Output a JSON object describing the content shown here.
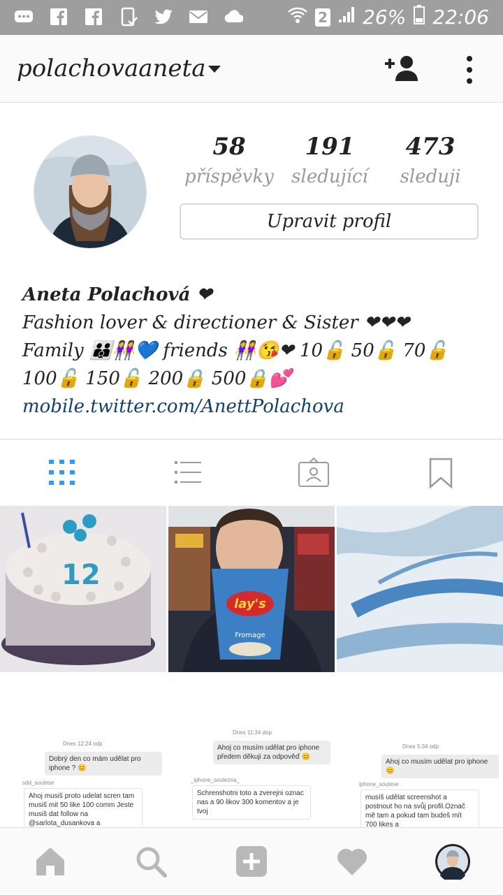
{
  "status_bar": {
    "icons": [
      "chat-icon",
      "facebook-icon",
      "facebook-icon",
      "phone-icon",
      "twitter-icon",
      "mail-icon",
      "cloud-icon"
    ],
    "sim": "2",
    "battery": "26%",
    "time": "22:06"
  },
  "header": {
    "username": "polachovaaneta"
  },
  "stats": [
    {
      "value": "58",
      "label": "příspěvky"
    },
    {
      "value": "191",
      "label": "sledující"
    },
    {
      "value": "473",
      "label": "sleduji"
    }
  ],
  "edit_profile_label": "Upravit profil",
  "bio": {
    "name": "Aneta Polachová ❤",
    "line1": "Fashion lover & directioner & Sister ❤❤❤",
    "line2": "Family 👪👭💙 friends 👭😘❤ 10🔓 50🔓 70🔓",
    "line3": "100🔓 150🔓 200🔒  500🔒💕",
    "link": "mobile.twitter.com/AnettPolachova"
  },
  "tabs": [
    "grid-icon",
    "list-icon",
    "tagged-icon",
    "saved-icon"
  ],
  "accent_color": "#3897f0",
  "posts": [
    {
      "caption_number": "12"
    },
    {
      "chip_brand": "lay's",
      "chip_flavor": "Fromage"
    },
    {}
  ],
  "screenshots": [
    {
      "time": "Dnes 12:24 odp",
      "q": "Dobrý den co mám udělat pro iphone ? 😊",
      "user": "sdd_soutese",
      "a": "Ahoj musiš proto udelat scren tam musiš mit 50 like 100 comm Jeste musiš dat follow na @sarlota_dusankova a"
    },
    {
      "time": "Dnes 11:34 dop",
      "q": "Ahoj co musím udělat pro iphone předem děkuji za odpověď 😊",
      "user": "_iphone_soutezna_",
      "a": "Schrenshotni toto a zverejni oznac nas a 90 likov 300 komentov a je tvoj"
    },
    {
      "time": "Dnes 5:34 odp",
      "q": "Ahoj co musím udělat pro iphone 😊",
      "user": "iphone_soutese",
      "a": "musíš udělat screenshot a postnout ho na svůj profil.Označ mě tam a pokud tam budeš mít 700 likes a"
    }
  ],
  "bottom_nav": [
    "home-icon",
    "search-icon",
    "add-icon",
    "heart-icon",
    "profile-avatar"
  ]
}
